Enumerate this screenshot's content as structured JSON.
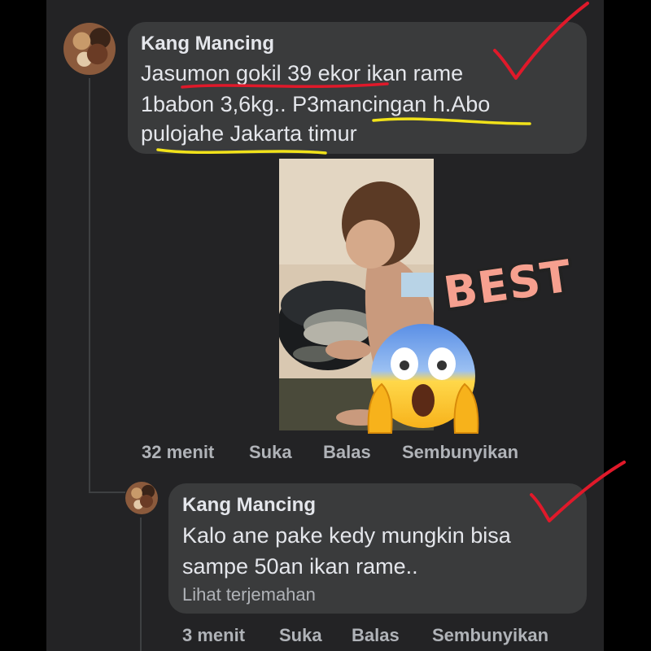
{
  "comment1": {
    "author": "Kang Mancing",
    "lines": [
      "Jasumon gokil 39 ekor ikan rame",
      "1babon 3,6kg.. P3mancingan h.Abo",
      "pulojahe Jakarta timur"
    ],
    "time": "32 menit",
    "like": "Suka",
    "reply": "Balas",
    "hide": "Sembunyikan"
  },
  "sticker_text": "BEST",
  "reply1": {
    "author": "Kang Mancing",
    "lines": [
      "Kalo ane pake kedy mungkin bisa",
      "sampe 50an ikan rame.."
    ],
    "translate": "Lihat terjemahan",
    "time": "3 menit",
    "like": "Suka",
    "reply": "Balas",
    "hide": "Sembunyikan"
  },
  "colors": {
    "background": "#232325",
    "bubble": "#3a3b3c",
    "text": "#e4e6eb",
    "meta": "#b0b3b8",
    "red_mark": "#e0192a",
    "yellow_mark": "#f1e21a"
  },
  "icons": [
    "checkmark-icon",
    "screaming-face-emoji-icon"
  ]
}
